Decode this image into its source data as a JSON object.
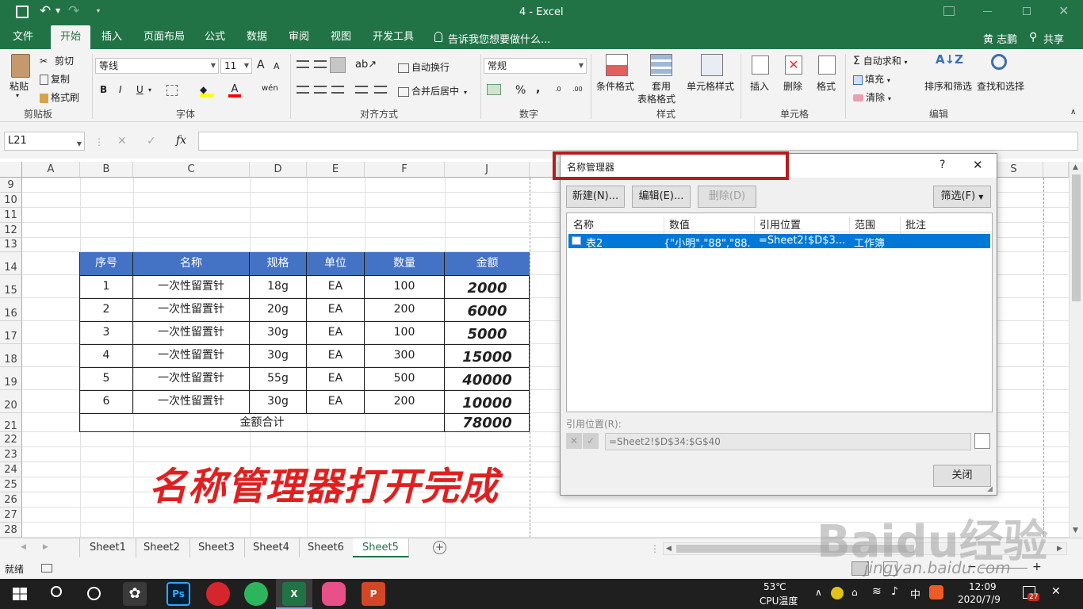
{
  "titlebar": {
    "title": "4 - Excel"
  },
  "menu": {
    "tabs": [
      "文件",
      "开始",
      "插入",
      "页面布局",
      "公式",
      "数据",
      "审阅",
      "视图",
      "开发工具"
    ],
    "tell_me": "告诉我您想要做什么...",
    "user": "黄 志鹏",
    "share": "共享"
  },
  "ribbon": {
    "clipboard": {
      "paste": "粘贴",
      "cut": "剪切",
      "copy": "复制",
      "format_painter": "格式刷",
      "label": "剪贴板"
    },
    "font": {
      "name": "等线",
      "size": "11",
      "label": "字体",
      "bold": "B",
      "italic": "I",
      "underline": "U",
      "grow": "A",
      "shrink": "A",
      "wen": "wén"
    },
    "alignment": {
      "wrap": "自动换行",
      "merge": "合并后居中",
      "label": "对齐方式"
    },
    "number": {
      "format": "常规",
      "label": "数字",
      "percent": "%",
      "comma": ","
    },
    "styles": {
      "conditional": "条件格式",
      "table1": "套用",
      "table2": "表格格式",
      "cell_styles": "单元格样式",
      "label": "样式"
    },
    "cells": {
      "insert": "插入",
      "delete": "删除",
      "format": "格式",
      "label": "单元格"
    },
    "editing": {
      "autosum": "自动求和",
      "fill": "填充",
      "clear": "清除",
      "sort": "排序和筛选",
      "find": "查找和选择",
      "label": "编辑"
    }
  },
  "formula": {
    "namebox": "L21",
    "fx": "fx",
    "value": ""
  },
  "columns": [
    "A",
    "B",
    "C",
    "D",
    "E",
    "F",
    "J",
    "S"
  ],
  "rows": [
    "9",
    "10",
    "11",
    "12",
    "13",
    "14",
    "15",
    "16",
    "17",
    "18",
    "19",
    "20",
    "21",
    "22",
    "23",
    "24",
    "25",
    "26",
    "27",
    "28"
  ],
  "table": {
    "headers": [
      "序号",
      "名称",
      "规格",
      "单位",
      "数量",
      "金额"
    ],
    "rows": [
      [
        "1",
        "一次性留置针",
        "18g",
        "EA",
        "100",
        "2000"
      ],
      [
        "2",
        "一次性留置针",
        "20g",
        "EA",
        "200",
        "6000"
      ],
      [
        "3",
        "一次性留置针",
        "30g",
        "EA",
        "100",
        "5000"
      ],
      [
        "4",
        "一次性留置针",
        "30g",
        "EA",
        "300",
        "15000"
      ],
      [
        "5",
        "一次性留置针",
        "55g",
        "EA",
        "500",
        "40000"
      ],
      [
        "6",
        "一次性留置针",
        "30g",
        "EA",
        "200",
        "10000"
      ]
    ],
    "total_label": "金额合计",
    "total_value": "78000"
  },
  "overlay_text": "名称管理器打开完成",
  "dialog": {
    "title": "名称管理器",
    "help": "?",
    "close_x": "✕",
    "new_btn": "新建(N)...",
    "edit_btn": "编辑(E)...",
    "delete_btn": "删除(D)",
    "filter_btn": "筛选(F)",
    "columns": [
      "名称",
      "数值",
      "引用位置",
      "范围",
      "批注"
    ],
    "entries": [
      {
        "name": "表2",
        "value": "{\"小明\",\"88\",\"88...",
        "ref": "=Sheet2!$D$3...",
        "scope": "工作簿",
        "comment": ""
      }
    ],
    "refers_label": "引用位置(R):",
    "refers_value": "=Sheet2!$D$34:$G$40",
    "close_btn": "关闭"
  },
  "sheets": [
    "Sheet1",
    "Sheet2",
    "Sheet3",
    "Sheet4",
    "Sheet6",
    "Sheet5"
  ],
  "active_sheet": "Sheet5",
  "status": {
    "ready": "就绪"
  },
  "watermark": {
    "brand": "Baidu经验",
    "url": "jingyan.baidu.com"
  },
  "taskbar": {
    "temp": "53℃",
    "temp_label": "CPU温度",
    "time": "12:09",
    "date": "2020/7/9",
    "ime": "中",
    "badge": "27"
  },
  "colors": {
    "excel_green": "#217346",
    "header_blue": "#4472c4",
    "highlight_red": "#e02020",
    "select_blue": "#0078d7"
  }
}
